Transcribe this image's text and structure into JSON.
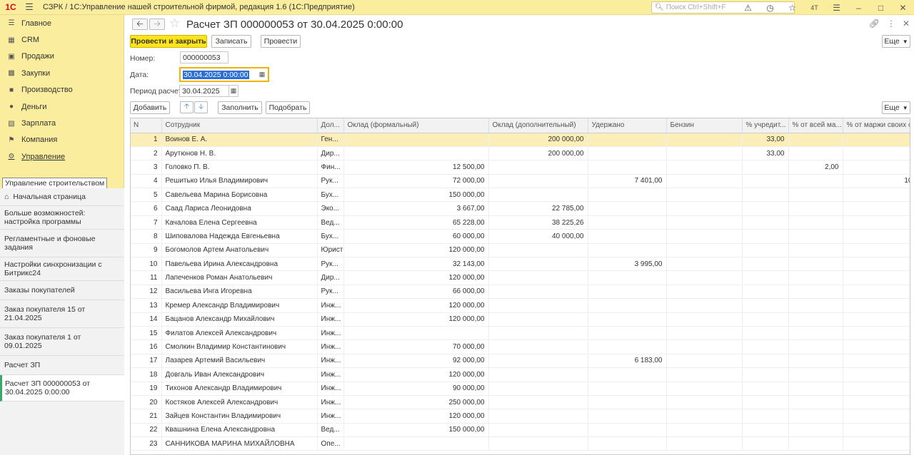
{
  "app": {
    "logo_text": "1С",
    "title": "СЗРК / 1С:Управление нашей строительной фирмой, редакция 1.6  (1С:Предприятие)",
    "search_placeholder": "Поиск Ctrl+Shift+F",
    "user_badge": "4Т"
  },
  "sidebar": {
    "items": [
      {
        "label": "Главное",
        "icon": "menu-icon"
      },
      {
        "label": "CRM",
        "icon": "crm-icon"
      },
      {
        "label": "Продажи",
        "icon": "cart-icon"
      },
      {
        "label": "Закупки",
        "icon": "truck-icon"
      },
      {
        "label": "Производство",
        "icon": "factory-icon"
      },
      {
        "label": "Деньги",
        "icon": "money-icon"
      },
      {
        "label": "Зарплата",
        "icon": "salary-icon"
      },
      {
        "label": "Компания",
        "icon": "flag-icon"
      },
      {
        "label": "Управление",
        "icon": "settings-icon"
      }
    ],
    "tooltip": "Управление строительством",
    "open_windows": [
      "Начальная страница",
      "Больше возможностей: настройка программы",
      "Регламентные и фоновые задания",
      "Настройки синхронизации с Битрикс24",
      "Заказы покупателей",
      "Заказ покупателя 15 от 21.04.2025",
      "Заказ покупателя 1 от 09.01.2025",
      "Расчет ЗП",
      "Расчет ЗП 000000053 от 30.04.2025 0:00:00"
    ]
  },
  "document": {
    "title": "Расчет ЗП 000000053 от 30.04.2025 0:00:00",
    "buttons": {
      "post_close": "Провести и закрыть",
      "save": "Записать",
      "post": "Провести",
      "more": "Еще",
      "add": "Добавить",
      "fill": "Заполнить",
      "pick": "Подобрать"
    },
    "fields": {
      "number_label": "Номер:",
      "number_value": "000000053",
      "date_label": "Дата:",
      "date_value": "30.04.2025  0:00:00",
      "period_label": "Период расчета:",
      "period_value": "30.04.2025"
    }
  },
  "table": {
    "columns": [
      "N",
      "Сотрудник",
      "Дол...",
      "Оклад  (формальный)",
      "Оклад (дополнительный)",
      "Удержано",
      "Бензин",
      "% учредит...",
      "% от всей ма...",
      "% от маржи своих объ..."
    ],
    "rows": [
      [
        "1",
        "Воинов Е. А.",
        "Ген...",
        "",
        "200 000,00",
        "",
        "",
        "33,00",
        "",
        ""
      ],
      [
        "2",
        "Арутюнов Н. В.",
        "Дир...",
        "",
        "200 000,00",
        "",
        "",
        "33,00",
        "",
        ""
      ],
      [
        "3",
        "Головко П. В.",
        "Фин...",
        "12 500,00",
        "",
        "",
        "",
        "",
        "2,00",
        ""
      ],
      [
        "4",
        "Решитько Илья Владимирович",
        "Рук...",
        "72 000,00",
        "",
        "7 401,00",
        "",
        "",
        "",
        "10"
      ],
      [
        "5",
        "Савельева Марина Борисовна",
        "Бух...",
        "150 000,00",
        "",
        "",
        "",
        "",
        "",
        ""
      ],
      [
        "6",
        "Саад Лариса Леонидовна",
        "Эко...",
        "3 667,00",
        "22 785,00",
        "",
        "",
        "",
        "",
        ""
      ],
      [
        "7",
        "Качалова Елена Сергеевна",
        "Вед...",
        "65 228,00",
        "38 225,26",
        "",
        "",
        "",
        "",
        ""
      ],
      [
        "8",
        "Шиповалова Надежда Евгеньевна",
        "Бух...",
        "60 000,00",
        "40 000,00",
        "",
        "",
        "",
        "",
        ""
      ],
      [
        "9",
        "Богомолов Артем Анатольевич",
        "Юрист",
        "120 000,00",
        "",
        "",
        "",
        "",
        "",
        ""
      ],
      [
        "10",
        "Павельева Ирина Александровна",
        "Рук...",
        "32 143,00",
        "",
        "3 995,00",
        "",
        "",
        "",
        ""
      ],
      [
        "11",
        "Лапеченков Роман Анатольевич",
        "Дир...",
        "120 000,00",
        "",
        "",
        "",
        "",
        "",
        ""
      ],
      [
        "12",
        "Васильева Инга Игоревна",
        "Рук...",
        "66 000,00",
        "",
        "",
        "",
        "",
        "",
        ""
      ],
      [
        "13",
        "Кремер Александр Владимирович",
        "Инж...",
        "120 000,00",
        "",
        "",
        "",
        "",
        "",
        ""
      ],
      [
        "14",
        "Бацанов Александр Михайлович",
        "Инж...",
        "120 000,00",
        "",
        "",
        "",
        "",
        "",
        ""
      ],
      [
        "15",
        "Филатов Алексей Александрович",
        "Инж...",
        "",
        "",
        "",
        "",
        "",
        "",
        ""
      ],
      [
        "16",
        "Смолкин Владимир Константинович",
        "Инж...",
        "70 000,00",
        "",
        "",
        "",
        "",
        "",
        ""
      ],
      [
        "17",
        "Лазарев Артемий Васильевич",
        "Инж...",
        "92 000,00",
        "",
        "6 183,00",
        "",
        "",
        "",
        ""
      ],
      [
        "18",
        "Довгаль Иван Александрович",
        "Инж...",
        "120 000,00",
        "",
        "",
        "",
        "",
        "",
        ""
      ],
      [
        "19",
        "Тихонов Александр Владимирович",
        "Инж...",
        "90 000,00",
        "",
        "",
        "",
        "",
        "",
        ""
      ],
      [
        "20",
        "Костяков Алексей Александрович",
        "Инж...",
        "250 000,00",
        "",
        "",
        "",
        "",
        "",
        ""
      ],
      [
        "21",
        "Зайцев Константин Владимирович",
        "Инж...",
        "120 000,00",
        "",
        "",
        "",
        "",
        "",
        ""
      ],
      [
        "22",
        "Квашнина Елена Александровна",
        "Вед...",
        "150 000,00",
        "",
        "",
        "",
        "",
        "",
        ""
      ],
      [
        "23",
        "САННИКОВА МАРИНА МИХАЙЛОВНА",
        "Опе...",
        "",
        "",
        "",
        "",
        "",
        "",
        ""
      ]
    ]
  }
}
